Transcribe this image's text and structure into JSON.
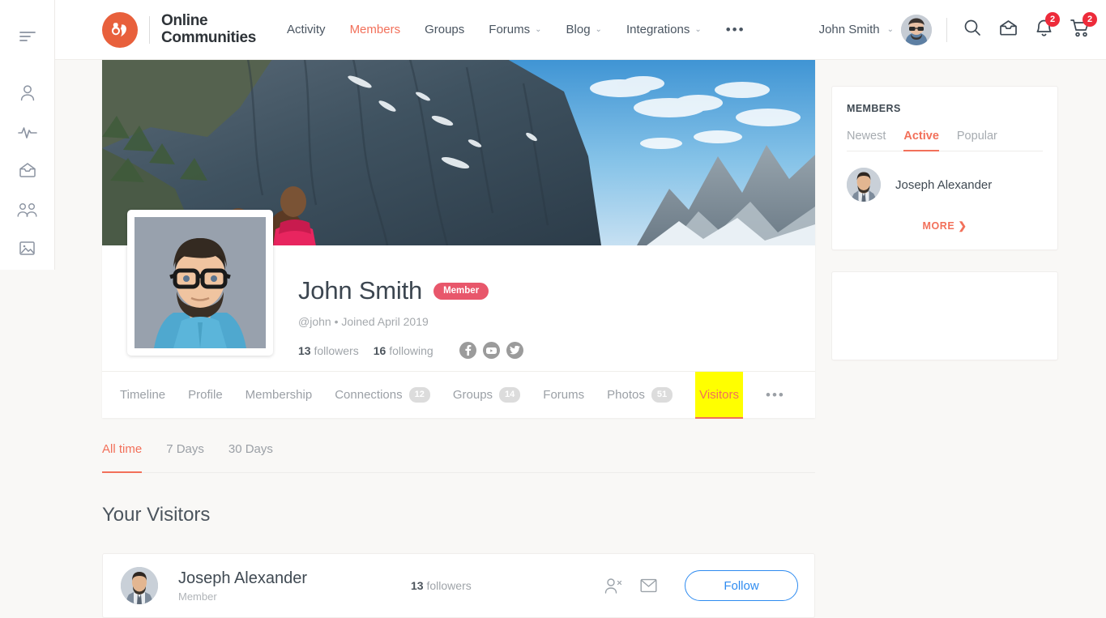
{
  "sidebar": {
    "items": [
      {
        "name": "menu-toggle",
        "icon": "hamburger-icon"
      },
      {
        "name": "profile",
        "icon": "user-icon"
      },
      {
        "name": "activity",
        "icon": "activity-pulse-icon"
      },
      {
        "name": "messages",
        "icon": "inbox-icon"
      },
      {
        "name": "groups",
        "icon": "group-icon"
      },
      {
        "name": "photos",
        "icon": "image-icon"
      }
    ]
  },
  "header": {
    "brand_line1": "Online",
    "brand_line2": "Communities",
    "logo_icon": "buddyboss-logo-icon",
    "nav": [
      {
        "label": "Activity",
        "has_caret": false,
        "active": false
      },
      {
        "label": "Members",
        "has_caret": false,
        "active": true
      },
      {
        "label": "Groups",
        "has_caret": false,
        "active": false
      },
      {
        "label": "Forums",
        "has_caret": true,
        "active": false
      },
      {
        "label": "Blog",
        "has_caret": true,
        "active": false
      },
      {
        "label": "Integrations",
        "has_caret": true,
        "active": false
      }
    ],
    "nav_more": "•••",
    "user_name": "John Smith",
    "user_caret": "⌄",
    "icons": [
      {
        "name": "search-icon",
        "badge": ""
      },
      {
        "name": "inbox-icon",
        "badge": ""
      },
      {
        "name": "notifications-bell-icon",
        "badge": "2"
      },
      {
        "name": "cart-icon",
        "badge": "2"
      }
    ],
    "accent_color": "#f2705a",
    "badge_color": "#ed2b3a"
  },
  "profile": {
    "cover_image": "mountain-cliff-landscape-photo",
    "avatar_image": "john-smith-portrait",
    "name": "John Smith",
    "badge": "Member",
    "handle": "@john",
    "separator": "•",
    "joined": "Joined April 2019",
    "followers_count": "13",
    "followers_label": "followers",
    "following_count": "16",
    "following_label": "following",
    "socials": [
      {
        "name": "facebook-icon",
        "glyph": "f"
      },
      {
        "name": "youtube-icon",
        "glyph": "▶"
      },
      {
        "name": "twitter-icon",
        "glyph": "t"
      }
    ],
    "tabs": [
      {
        "label": "Timeline",
        "count": "",
        "selected": false
      },
      {
        "label": "Profile",
        "count": "",
        "selected": false
      },
      {
        "label": "Membership",
        "count": "",
        "selected": false
      },
      {
        "label": "Connections",
        "count": "12",
        "selected": false
      },
      {
        "label": "Groups",
        "count": "14",
        "selected": false
      },
      {
        "label": "Forums",
        "count": "",
        "selected": false
      },
      {
        "label": "Photos",
        "count": "51",
        "selected": false
      },
      {
        "label": "Visitors",
        "count": "",
        "selected": true
      }
    ],
    "tabs_more": "•••",
    "highlight_color": "#ffff00"
  },
  "visitors": {
    "filters": [
      {
        "label": "All time",
        "selected": true
      },
      {
        "label": "7 Days",
        "selected": false
      },
      {
        "label": "30 Days",
        "selected": false
      }
    ],
    "section_title": "Your Visitors",
    "rows": [
      {
        "avatar": "joseph-alexander-portrait",
        "name": "Joseph Alexander",
        "role": "Member",
        "followers_count": "13",
        "followers_label": "followers",
        "action_icons": [
          "remove-friend-icon",
          "message-envelope-icon"
        ],
        "follow_label": "Follow"
      }
    ],
    "follow_color": "#2e8bf0"
  },
  "members_widget": {
    "title": "MEMBERS",
    "tabs": [
      {
        "label": "Newest",
        "selected": false
      },
      {
        "label": "Active",
        "selected": true
      },
      {
        "label": "Popular",
        "selected": false
      }
    ],
    "members": [
      {
        "avatar": "joseph-alexander-portrait",
        "name": "Joseph Alexander"
      }
    ],
    "more_label": "MORE",
    "more_chevron": "❯"
  }
}
